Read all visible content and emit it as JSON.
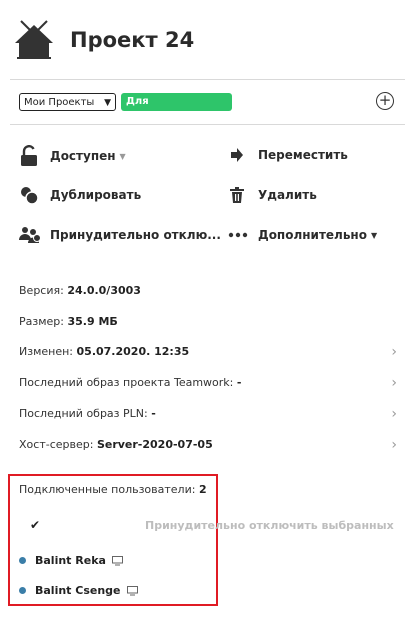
{
  "header": {
    "title": "Проект 24"
  },
  "filters": {
    "project_select": "Мои Проекты",
    "publication_badge": "Для Публикации"
  },
  "actions": {
    "available": "Доступен",
    "move": "Переместить",
    "duplicate": "Дублировать",
    "delete": "Удалить",
    "force_disconnect": "Принудительно отклю...",
    "more": "Дополнительно"
  },
  "details": {
    "version_label": "Версия:",
    "version_value": "24.0.0/3003",
    "size_label": "Размер:",
    "size_value": "35.9 МБ",
    "modified_label": "Изменен:",
    "modified_value": "05.07.2020. 12:35",
    "teamwork_label": "Последний образ проекта Teamwork:",
    "teamwork_value": "-",
    "pln_label": "Последний образ PLN:",
    "pln_value": "-",
    "host_label": "Хост-сервер:",
    "host_value": "Server-2020-07-05"
  },
  "users": {
    "label": "Подключенные пользователи:",
    "count": "2",
    "disconnect_selected": "Принудительно отключить выбранных",
    "list": [
      {
        "name": "Balint Reka"
      },
      {
        "name": "Balint Csenge"
      }
    ]
  },
  "colors": {
    "accent_green": "#2ec56a",
    "highlight_red": "#e01b24",
    "user_dot": "#3b7ea8"
  }
}
